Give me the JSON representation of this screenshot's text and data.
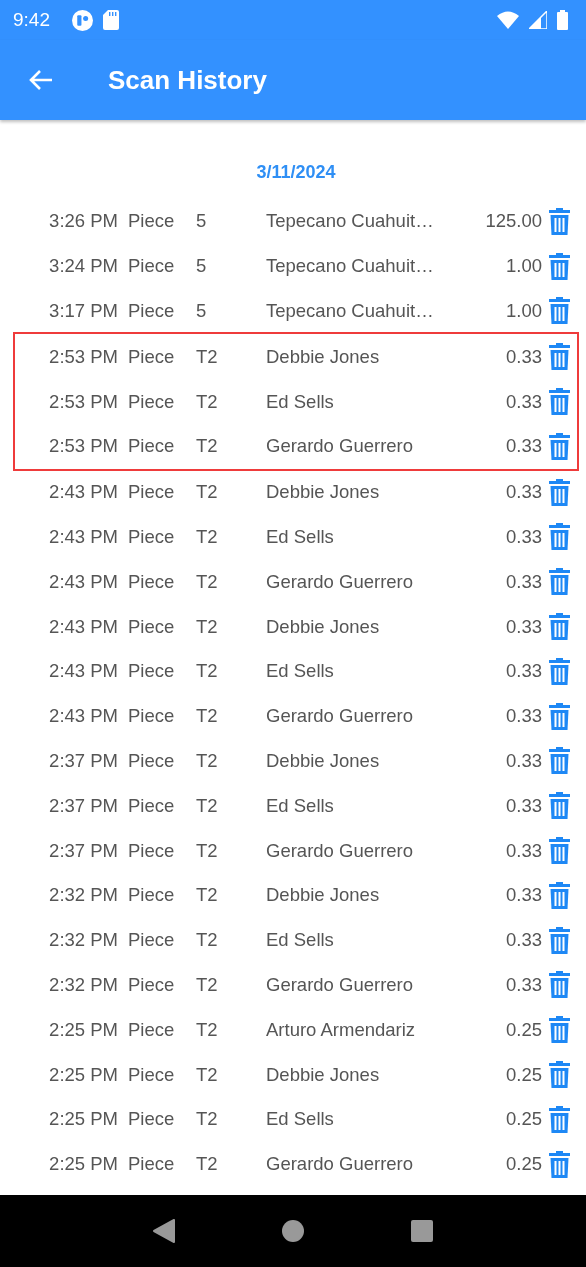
{
  "status_bar": {
    "time": "9:42"
  },
  "app_bar": {
    "title": "Scan History"
  },
  "date": "3/11/2024",
  "rows": [
    {
      "time": "3:26 PM",
      "type": "Piece",
      "code": "5",
      "name": "Tepecano Cuahuit…",
      "amount": "125.00",
      "highlighted": false
    },
    {
      "time": "3:24 PM",
      "type": "Piece",
      "code": "5",
      "name": "Tepecano Cuahuit…",
      "amount": "1.00",
      "highlighted": false
    },
    {
      "time": "3:17 PM",
      "type": "Piece",
      "code": "5",
      "name": "Tepecano Cuahuit…",
      "amount": "1.00",
      "highlighted": false
    },
    {
      "time": "2:53 PM",
      "type": "Piece",
      "code": "T2",
      "name": "Debbie Jones",
      "amount": "0.33",
      "highlighted": true
    },
    {
      "time": "2:53 PM",
      "type": "Piece",
      "code": "T2",
      "name": "Ed Sells",
      "amount": "0.33",
      "highlighted": true
    },
    {
      "time": "2:53 PM",
      "type": "Piece",
      "code": "T2",
      "name": "Gerardo Guerrero",
      "amount": "0.33",
      "highlighted": true
    },
    {
      "time": "2:43 PM",
      "type": "Piece",
      "code": "T2",
      "name": "Debbie Jones",
      "amount": "0.33",
      "highlighted": false
    },
    {
      "time": "2:43 PM",
      "type": "Piece",
      "code": "T2",
      "name": "Ed Sells",
      "amount": "0.33",
      "highlighted": false
    },
    {
      "time": "2:43 PM",
      "type": "Piece",
      "code": "T2",
      "name": "Gerardo Guerrero",
      "amount": "0.33",
      "highlighted": false
    },
    {
      "time": "2:43 PM",
      "type": "Piece",
      "code": "T2",
      "name": "Debbie Jones",
      "amount": "0.33",
      "highlighted": false
    },
    {
      "time": "2:43 PM",
      "type": "Piece",
      "code": "T2",
      "name": "Ed Sells",
      "amount": "0.33",
      "highlighted": false
    },
    {
      "time": "2:43 PM",
      "type": "Piece",
      "code": "T2",
      "name": "Gerardo Guerrero",
      "amount": "0.33",
      "highlighted": false
    },
    {
      "time": "2:37 PM",
      "type": "Piece",
      "code": "T2",
      "name": "Debbie Jones",
      "amount": "0.33",
      "highlighted": false
    },
    {
      "time": "2:37 PM",
      "type": "Piece",
      "code": "T2",
      "name": "Ed Sells",
      "amount": "0.33",
      "highlighted": false
    },
    {
      "time": "2:37 PM",
      "type": "Piece",
      "code": "T2",
      "name": "Gerardo Guerrero",
      "amount": "0.33",
      "highlighted": false
    },
    {
      "time": "2:32 PM",
      "type": "Piece",
      "code": "T2",
      "name": "Debbie Jones",
      "amount": "0.33",
      "highlighted": false
    },
    {
      "time": "2:32 PM",
      "type": "Piece",
      "code": "T2",
      "name": "Ed Sells",
      "amount": "0.33",
      "highlighted": false
    },
    {
      "time": "2:32 PM",
      "type": "Piece",
      "code": "T2",
      "name": "Gerardo Guerrero",
      "amount": "0.33",
      "highlighted": false
    },
    {
      "time": "2:25 PM",
      "type": "Piece",
      "code": "T2",
      "name": "Arturo Armendariz",
      "amount": "0.25",
      "highlighted": false
    },
    {
      "time": "2:25 PM",
      "type": "Piece",
      "code": "T2",
      "name": "Debbie Jones",
      "amount": "0.25",
      "highlighted": false
    },
    {
      "time": "2:25 PM",
      "type": "Piece",
      "code": "T2",
      "name": "Ed Sells",
      "amount": "0.25",
      "highlighted": false
    },
    {
      "time": "2:25 PM",
      "type": "Piece",
      "code": "T2",
      "name": "Gerardo Guerrero",
      "amount": "0.25",
      "highlighted": false
    }
  ]
}
